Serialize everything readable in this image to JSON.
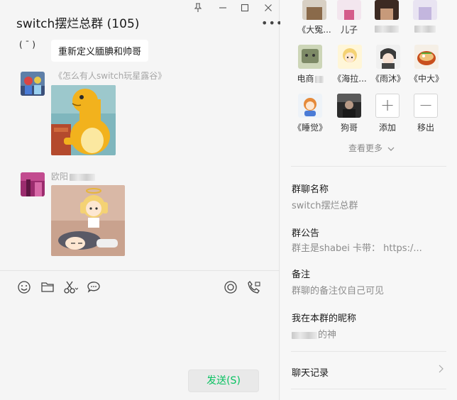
{
  "window": {
    "pin": "📌",
    "minimize": "–",
    "maximize": "□",
    "close": "✕"
  },
  "chat": {
    "title": "switch摆烂总群 (105)",
    "more": "•••",
    "previous_fragment": "( ¯ )",
    "previous_message": "重新定义腼腆和帅哥",
    "messages": [
      {
        "sender": "《怎么有人switch玩星露谷》",
        "type": "sticker"
      },
      {
        "sender": "欧阳",
        "type": "sticker"
      }
    ],
    "send_label": "发送(S)"
  },
  "info": {
    "members_top": [
      {
        "name": "《大冤..."
      },
      {
        "name": "儿子"
      },
      {
        "name": ""
      },
      {
        "name": ""
      }
    ],
    "members": [
      {
        "name": "电商"
      },
      {
        "name": "《海拉..."
      },
      {
        "name": "《雨沐》"
      },
      {
        "name": "《中大》"
      },
      {
        "name": "《睡觉》"
      },
      {
        "name": "狗哥"
      },
      {
        "name": "添加"
      },
      {
        "name": "移出"
      }
    ],
    "see_more": "查看更多",
    "group_name_label": "群聊名称",
    "group_name": "switch摆烂总群",
    "notice_label": "群公告",
    "notice": "群主是shabei  卡带：  https:/...",
    "remark_label": "备注",
    "remark": "群聊的备注仅自己可见",
    "nickname_label": "我在本群的昵称",
    "nickname": "的神",
    "history_label": "聊天记录"
  }
}
